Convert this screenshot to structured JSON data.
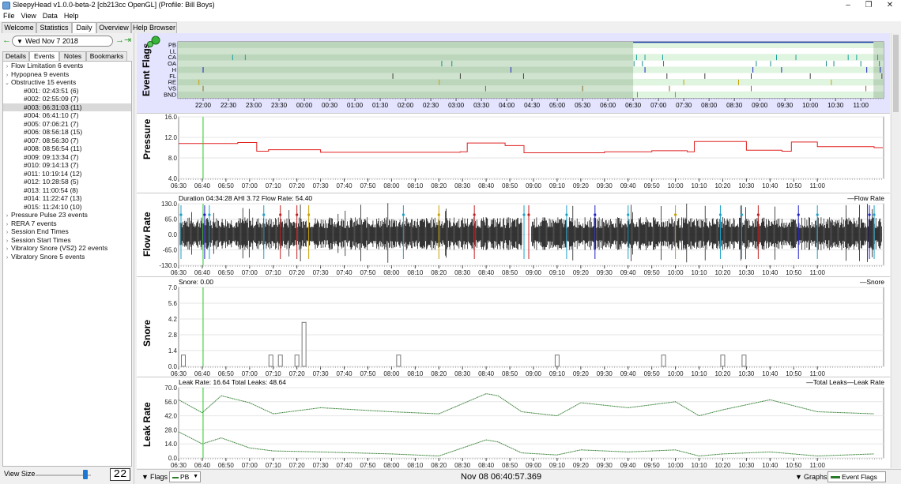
{
  "window": {
    "title": "SleepyHead v1.0.0-beta-2 [cb213cc OpenGL] (Profile: Bill Boys)",
    "minimize": "–",
    "maximize": "❐",
    "close": "✕"
  },
  "menu": [
    "File",
    "View",
    "Data",
    "Help"
  ],
  "tabs": [
    "Welcome",
    "Statistics",
    "Daily",
    "Overview",
    "Help Browser"
  ],
  "active_tab": "Daily",
  "date_nav": {
    "date": "Wed Nov 7 2018",
    "prev": "←",
    "next": "→",
    "last": "⇥",
    "dropdown": "▼"
  },
  "subtabs": [
    "Details",
    "Events",
    "Notes",
    "Bookmarks"
  ],
  "active_subtab": "Events",
  "event_list": [
    {
      "text": "Flow Limitation 6 events",
      "level": 0,
      "expanded": false
    },
    {
      "text": "Hypopnea 9 events",
      "level": 0,
      "expanded": false
    },
    {
      "text": "Obstructive 15 events",
      "level": 0,
      "expanded": true
    },
    {
      "text": "#001: 02:43:51 (6)",
      "level": 1
    },
    {
      "text": "#002: 02:55:09 (7)",
      "level": 1
    },
    {
      "text": "#003: 06:31:03 (11)",
      "level": 1,
      "selected": true
    },
    {
      "text": "#004: 06:41:10 (7)",
      "level": 1
    },
    {
      "text": "#005: 07:06:21 (7)",
      "level": 1
    },
    {
      "text": "#006: 08:56:18 (15)",
      "level": 1
    },
    {
      "text": "#007: 08:56:30 (7)",
      "level": 1
    },
    {
      "text": "#008: 08:56:54 (11)",
      "level": 1
    },
    {
      "text": "#009: 09:13:34 (7)",
      "level": 1
    },
    {
      "text": "#010: 09:14:13 (7)",
      "level": 1
    },
    {
      "text": "#011: 10:19:14 (12)",
      "level": 1
    },
    {
      "text": "#012: 10:28:58 (5)",
      "level": 1
    },
    {
      "text": "#013: 11:00:54 (8)",
      "level": 1
    },
    {
      "text": "#014: 11:22:47 (13)",
      "level": 1
    },
    {
      "text": "#015: 11:24:10 (10)",
      "level": 1
    },
    {
      "text": "Pressure Pulse 23 events",
      "level": 0,
      "expanded": false
    },
    {
      "text": "RERA 7 events",
      "level": 0,
      "expanded": false
    },
    {
      "text": "Session End Times",
      "level": 0,
      "expanded": false
    },
    {
      "text": "Session Start Times",
      "level": 0,
      "expanded": false
    },
    {
      "text": "Vibratory Snore (VS2)  22 events",
      "level": 0,
      "expanded": false
    },
    {
      "text": "Vibratory Snore 5 events",
      "level": 0,
      "expanded": false
    }
  ],
  "view_size": {
    "label": "View Size",
    "value": "22",
    "level": 0.86
  },
  "event_flags": {
    "label": "Event Flags",
    "rows": [
      "PB",
      "LL",
      "CA",
      "OA",
      "H",
      "FL",
      "RE",
      "VS",
      "BND"
    ],
    "ticks": [
      "22:00",
      "22:30",
      "23:00",
      "23:30",
      "00:00",
      "00:30",
      "01:00",
      "01:30",
      "02:00",
      "02:30",
      "03:00",
      "03:30",
      "04:00",
      "04:30",
      "05:00",
      "05:30",
      "06:00",
      "06:30",
      "07:00",
      "07:30",
      "08:00",
      "08:30",
      "09:00",
      "09:30",
      "10:00",
      "10:30",
      "11:00"
    ],
    "row_colors": [
      "#1b3ea8",
      "#7a7a7a",
      "#1ba0a0",
      "#1a8a8a",
      "#2020c8",
      "#404040",
      "#c8a000",
      "#8a6a2a",
      "#e06060"
    ]
  },
  "time_ticks": [
    "06:30",
    "06:40",
    "06:50",
    "07:00",
    "07:10",
    "07:20",
    "07:30",
    "07:40",
    "07:50",
    "08:00",
    "08:10",
    "08:20",
    "08:30",
    "08:40",
    "08:50",
    "09:00",
    "09:10",
    "09:20",
    "09:30",
    "09:40",
    "09:50",
    "10:00",
    "10:10",
    "10:20",
    "10:30",
    "10:40",
    "10:50",
    "11:00"
  ],
  "pressure": {
    "label": "Pressure",
    "yticks": [
      "16.0",
      "12.0",
      "8.0",
      "4.0"
    ]
  },
  "flow_rate": {
    "label": "Flow Rate",
    "info": "Duration 04:34:28 AHI 3.72 Flow Rate: 54.40",
    "legend": "—Flow Rate",
    "yticks": [
      "130.0",
      "65.0",
      "0.0",
      "-65.0",
      "-130.0"
    ]
  },
  "snore": {
    "label": "Snore",
    "info": "Snore: 0.00",
    "legend": "—Snore",
    "yticks": [
      "7.0",
      "5.6",
      "4.2",
      "2.8",
      "1.4",
      "0.0"
    ]
  },
  "leak_rate": {
    "label": "Leak Rate",
    "info": "Leak Rate: 16.64 Total Leaks: 48.64",
    "legend": "—Total Leaks—Leak Rate",
    "yticks": [
      "70.0",
      "56.0",
      "42.0",
      "28.0",
      "14.0",
      "0.0"
    ]
  },
  "statusbar": {
    "datetime": "Nov 08 06:40:57.369",
    "flags_label": "Flags",
    "flags_value": "PB",
    "graphs_label": "Graphs",
    "graphs_value": "Event Flags",
    "dropdown": "▼"
  },
  "chart_data": [
    {
      "type": "line",
      "ylabel": "Pressure",
      "ylim": [
        4,
        16
      ],
      "x": [
        "06:30",
        "06:55",
        "07:03",
        "07:08",
        "07:30",
        "08:29",
        "08:32",
        "08:48",
        "08:56",
        "09:30",
        "09:50",
        "10:05",
        "10:08",
        "10:30",
        "10:45",
        "10:49",
        "11:00",
        "11:24"
      ],
      "series": [
        {
          "values": [
            10.8,
            11.0,
            9.3,
            9.6,
            9.1,
            9.2,
            10.9,
            10.4,
            9.0,
            9.2,
            9.4,
            9.2,
            11.2,
            9.5,
            9.3,
            11.1,
            10.2,
            10.0
          ]
        }
      ]
    },
    {
      "type": "bar",
      "ylabel": "Snore",
      "ylim": [
        0,
        7
      ],
      "categories": [
        "06:32",
        "07:09",
        "07:13",
        "07:20",
        "07:23",
        "08:03",
        "09:10",
        "09:55",
        "10:20",
        "10:29"
      ],
      "values": [
        1,
        1,
        1,
        1,
        3.9,
        1,
        1,
        1,
        1,
        1
      ]
    },
    {
      "type": "line",
      "ylabel": "Leak Rate",
      "ylim": [
        0,
        70
      ],
      "x": [
        "06:30",
        "06:40",
        "06:48",
        "07:00",
        "07:10",
        "07:30",
        "08:00",
        "08:20",
        "08:40",
        "08:45",
        "08:55",
        "09:10",
        "09:20",
        "09:40",
        "10:00",
        "10:10",
        "10:20",
        "10:40",
        "11:00",
        "11:24"
      ],
      "series": [
        {
          "name": "Total Leaks",
          "values": [
            58,
            45,
            62,
            55,
            44,
            50,
            46,
            44,
            64,
            62,
            46,
            42,
            55,
            50,
            56,
            42,
            48,
            58,
            46,
            44
          ]
        },
        {
          "name": "Leak Rate",
          "values": [
            26,
            14,
            20,
            10,
            7,
            6,
            4,
            2,
            18,
            16,
            5,
            3,
            8,
            6,
            8,
            2,
            4,
            6,
            2,
            4
          ]
        }
      ]
    }
  ]
}
